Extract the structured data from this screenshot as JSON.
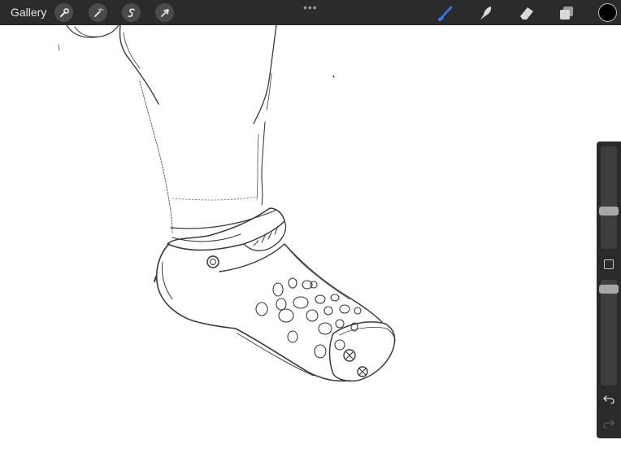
{
  "app": {
    "gallery_label": "Gallery",
    "accent_color": "#2f7cf6",
    "toolbar_bg": "#2b2b2b"
  },
  "left_tools": [
    {
      "name": "actions",
      "icon": "wrench-icon"
    },
    {
      "name": "adjustments",
      "icon": "magic-wand-icon"
    },
    {
      "name": "selection",
      "icon": "selection-s-icon"
    },
    {
      "name": "transform",
      "icon": "arrow-cursor-icon"
    }
  ],
  "right_tools": [
    {
      "name": "brush",
      "icon": "brush-icon",
      "active": true
    },
    {
      "name": "smudge",
      "icon": "smudge-icon",
      "active": false
    },
    {
      "name": "eraser",
      "icon": "eraser-icon",
      "active": false
    },
    {
      "name": "layers",
      "icon": "layers-icon",
      "active": false
    }
  ],
  "current_color": "#000000",
  "sidebar": {
    "brush_size": 0.36,
    "brush_opacity": 0.95
  }
}
